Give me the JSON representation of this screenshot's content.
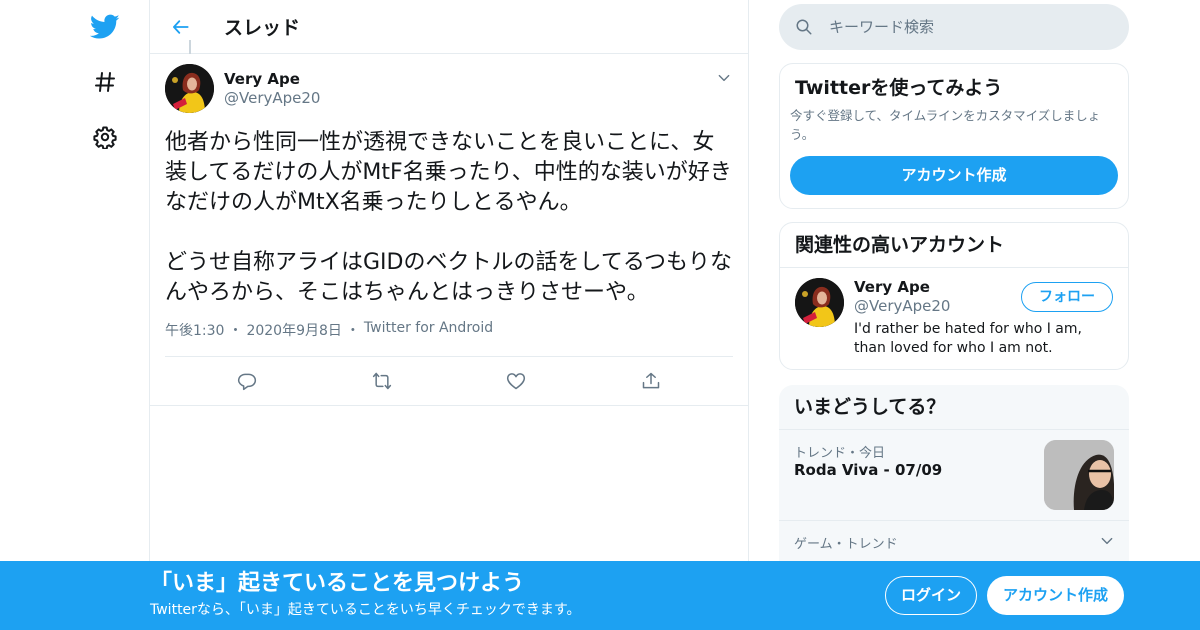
{
  "nav": {
    "icons": [
      "twitter-logo-icon",
      "hashtag-icon",
      "gear-icon"
    ]
  },
  "colors": {
    "brand": "#1da1f2",
    "text": "#14171a",
    "secondary": "#657786",
    "border": "#e6ecf0"
  },
  "header": {
    "title": "スレッド"
  },
  "tweet": {
    "display_name": "Very Ape",
    "handle": "@VeryApe20",
    "text": "他者から性同一性が透視できないことを良いことに、女装してるだけの人がMtF名乗ったり、中性的な装いが好きなだけの人がMtX名乗ったりしとるやん。\n\nどうせ自称アライはGIDのベクトルの話をしてるつもりなんやろから、そこはちゃんとはっきりさせーや。",
    "time": "午後1:30",
    "date": "2020年9月8日",
    "source": "Twitter for Android",
    "sep": "・"
  },
  "search": {
    "placeholder": "キーワード検索"
  },
  "signup_card": {
    "title": "Twitterを使ってみよう",
    "subtitle": "今すぐ登録して、タイムラインをカスタマイズしましょう。",
    "button": "アカウント作成"
  },
  "related": {
    "title": "関連性の高いアカウント",
    "display_name": "Very Ape",
    "handle": "@VeryApe20",
    "follow": "フォロー",
    "bio": "I'd rather be hated for who I am, than loved for who I am not."
  },
  "trends": {
    "title": "いまどうしてる？",
    "items": [
      {
        "meta": "トレンド・今日",
        "name": "Roda Viva - 07/09"
      },
      {
        "meta": "ゲーム・トレンド"
      }
    ]
  },
  "banner": {
    "title": "「いま」起きていることを見つけよう",
    "subtitle": "Twitterなら、「いま」起きていることをいち早くチェックできます。",
    "login": "ログイン",
    "signup": "アカウント作成"
  }
}
